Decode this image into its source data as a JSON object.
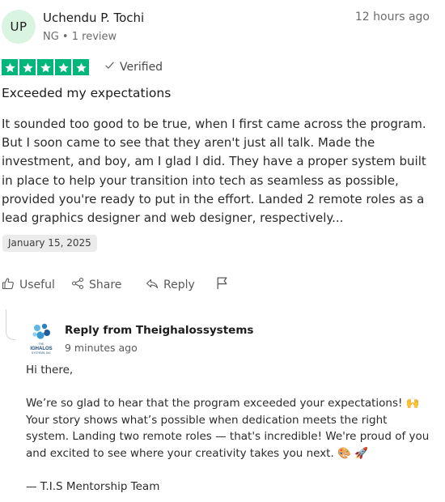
{
  "reviewer": {
    "initials": "UP",
    "name": "Uchendu P. Tochi",
    "meta": "NG • 1 review",
    "time": "12 hours ago"
  },
  "rating": {
    "stars": 5,
    "max_stars": 5,
    "star_color": "#00b67a",
    "verified_label": "Verified"
  },
  "review": {
    "title": "Exceeded my expectations",
    "body": "It sounded too good to be true, when I first came across the program. But I soon came to see that they aren't just all talk. Made the investment, and boy, am I glad I did. They have a proper system built in place to help your transition into tech as seamless as possible, provided you're ready to put in the effort. Landed 2 remote roles as a lead graphics designer and web designer, respectively...",
    "date": "January 15, 2025"
  },
  "actions": {
    "useful": "Useful",
    "share": "Share",
    "reply": "Reply"
  },
  "company_reply": {
    "from": "Reply from Theighalossystems",
    "time": "9 minutes ago",
    "logo_text_top": "THE",
    "logo_text_mid": "IGHALOS",
    "logo_text_bottom": "SYSTEMS, INC",
    "greeting": "Hi there,",
    "body": "We’re so glad to hear that the program exceeded your expectations! 🙌 Your story shows what’s possible when dedication meets the right system. Landing two remote roles — that's incredible! We're proud of you and excited to see where your creativity takes you next. 🎨 🚀",
    "signature": "— T.I.S Mentorship Team"
  }
}
